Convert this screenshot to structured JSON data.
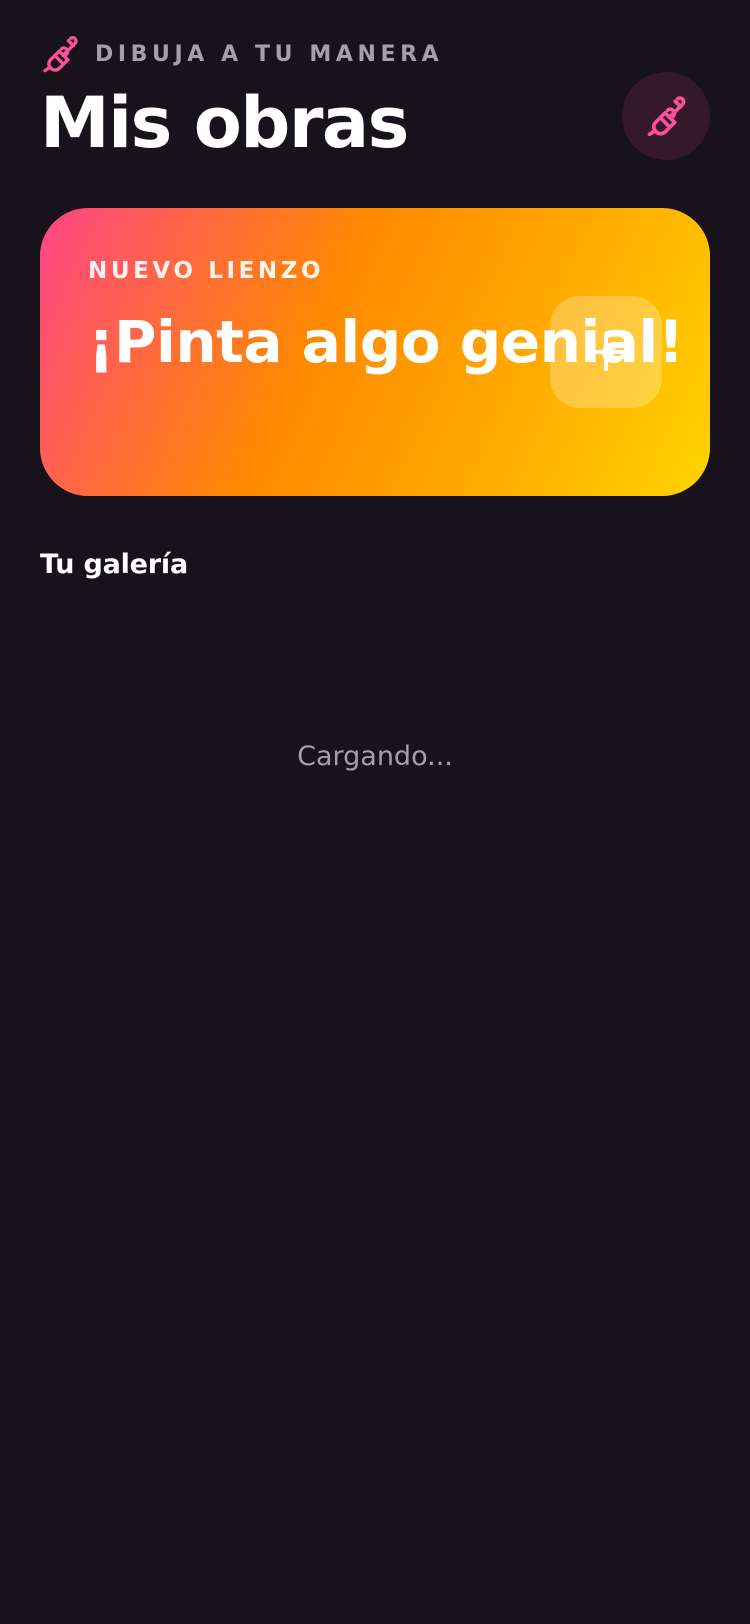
{
  "header": {
    "eyebrow": "DIBUJA A TU MANERA",
    "eyebrow_icon": "paint-brush-icon",
    "title": "Mis obras",
    "action_icon": "paint-brush-icon"
  },
  "new_canvas": {
    "eyebrow": "NUEVO LIENZO",
    "title": "¡Pinta algo genial!",
    "button_icon": "plus-icon"
  },
  "gallery": {
    "title": "Tu galería",
    "status": "Cargando..."
  },
  "colors": {
    "background": "#18131a",
    "accent": "#ff4f9a",
    "muted_text": "#a79fa8",
    "icon_circle": "#33192a",
    "gradient": [
      "#ff4587",
      "#ff8a00",
      "#ffd400"
    ]
  }
}
